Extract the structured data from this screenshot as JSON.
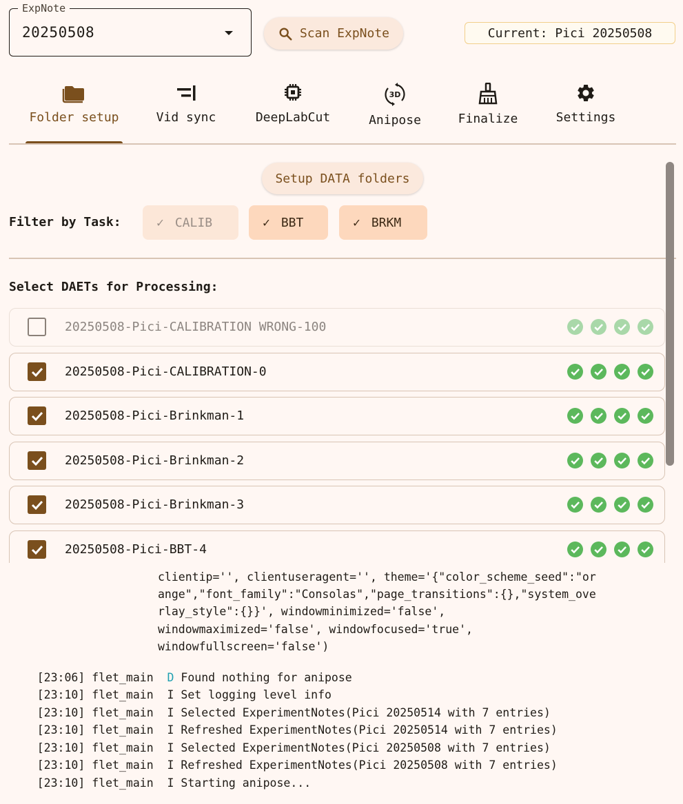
{
  "header": {
    "expnote_label": "ExpNote",
    "expnote_value": "20250508",
    "scan_button": "Scan ExpNote",
    "current": "Current: Pici 20250508"
  },
  "tabs": [
    {
      "label": "Folder setup",
      "icon": "folder-icon",
      "active": true
    },
    {
      "label": "Vid sync",
      "icon": "sync-align-icon",
      "active": false
    },
    {
      "label": "DeepLabCut",
      "icon": "chip-icon",
      "active": false
    },
    {
      "label": "Anipose",
      "icon": "rotate-3d-icon",
      "active": false
    },
    {
      "label": "Finalize",
      "icon": "broom-icon",
      "active": false
    },
    {
      "label": "Settings",
      "icon": "gear-icon",
      "active": false
    }
  ],
  "setup_button": "Setup DATA folders",
  "filter": {
    "label": "Filter by Task:",
    "chips": [
      {
        "label": "CALIB",
        "selected": true,
        "enabled": false
      },
      {
        "label": "BBT",
        "selected": true,
        "enabled": true
      },
      {
        "label": "BRKM",
        "selected": true,
        "enabled": true
      }
    ]
  },
  "select_label": "Select DAETs for Processing:",
  "daets": [
    {
      "name": "20250508-Pici-CALIBRATION WRONG-100",
      "checked": false,
      "enabled": false,
      "status": [
        "ok",
        "ok",
        "ok",
        "ok"
      ]
    },
    {
      "name": "20250508-Pici-CALIBRATION-0",
      "checked": true,
      "enabled": true,
      "status": [
        "ok",
        "ok",
        "ok",
        "ok"
      ]
    },
    {
      "name": "20250508-Pici-Brinkman-1",
      "checked": true,
      "enabled": true,
      "status": [
        "ok",
        "ok",
        "ok",
        "ok"
      ]
    },
    {
      "name": "20250508-Pici-Brinkman-2",
      "checked": true,
      "enabled": true,
      "status": [
        "ok",
        "ok",
        "ok",
        "ok"
      ]
    },
    {
      "name": "20250508-Pici-Brinkman-3",
      "checked": true,
      "enabled": true,
      "status": [
        "ok",
        "ok",
        "ok",
        "ok"
      ]
    },
    {
      "name": "20250508-Pici-BBT-4",
      "checked": true,
      "enabled": true,
      "status": [
        "ok",
        "ok",
        "ok",
        "ok"
      ]
    }
  ],
  "colors": {
    "accent": "#7a4f1d",
    "ok_green": "#5cb85c",
    "ok_green_faded": "#a9d8a9"
  },
  "log": {
    "continuation": [
      "clientip='', clientuseragent='', theme='{\"color_scheme_seed\":\"or",
      "ange\",\"font_family\":\"Consolas\",\"page_transitions\":{},\"system_ove",
      "rlay_style\":{}}', windowminimized='false',",
      "windowmaximized='false', windowfocused='true',",
      "windowfullscreen='false')"
    ],
    "lines": [
      {
        "time": "[23:06]",
        "source": "flet_main",
        "level": "D",
        "message": "Found nothing for anipose"
      },
      {
        "time": "[23:10]",
        "source": "flet_main",
        "level": "I",
        "message": "Set logging level info"
      },
      {
        "time": "[23:10]",
        "source": "flet_main",
        "level": "I",
        "message": "Selected ExperimentNotes(Pici 20250514 with 7 entries)"
      },
      {
        "time": "[23:10]",
        "source": "flet_main",
        "level": "I",
        "message": "Refreshed ExperimentNotes(Pici 20250514 with 7 entries)"
      },
      {
        "time": "[23:10]",
        "source": "flet_main",
        "level": "I",
        "message": "Selected ExperimentNotes(Pici 20250508 with 7 entries)"
      },
      {
        "time": "[23:10]",
        "source": "flet_main",
        "level": "I",
        "message": "Refreshed ExperimentNotes(Pici 20250508 with 7 entries)"
      },
      {
        "time": "[23:10]",
        "source": "flet_main",
        "level": "I",
        "message": "Starting anipose..."
      }
    ]
  }
}
